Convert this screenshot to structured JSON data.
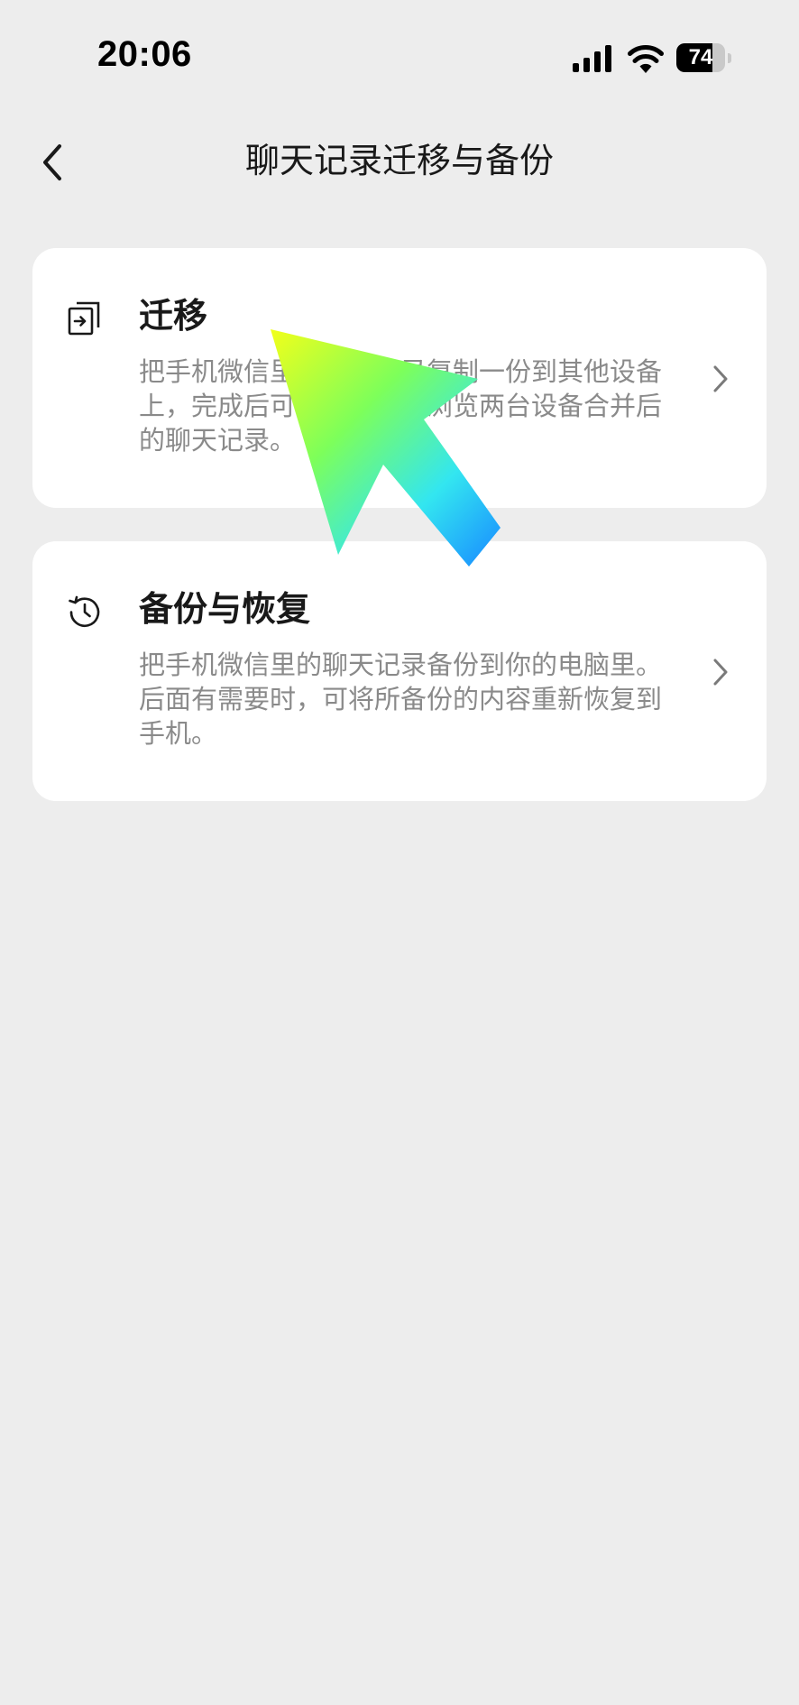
{
  "status_bar": {
    "time": "20:06",
    "battery_level": "74",
    "battery_fraction": 0.74,
    "icons": [
      "signal-icon",
      "wifi-icon",
      "battery-icon"
    ]
  },
  "nav": {
    "title": "聊天记录迁移与备份",
    "back_icon": "chevron-left-icon"
  },
  "cards": [
    {
      "icon": "migrate-icon",
      "title": "迁移",
      "description": "把手机微信里的聊天记录复制一份到其他设备上，完成后可在该设备上浏览两台设备合并后的聊天记录。"
    },
    {
      "icon": "history-clock-icon",
      "title": "备份与恢复",
      "description": "把手机微信里的聊天记录备份到你的电脑里。后面有需要时，可将所备份的内容重新恢复到手机。"
    }
  ],
  "colors": {
    "background": "#ededed",
    "card": "#ffffff",
    "title_text": "#191919",
    "description_text": "#8a8a8a",
    "arrow_gradient": [
      "#f2ff1a",
      "#7dff5a",
      "#33e6f0",
      "#1a90ff"
    ]
  }
}
